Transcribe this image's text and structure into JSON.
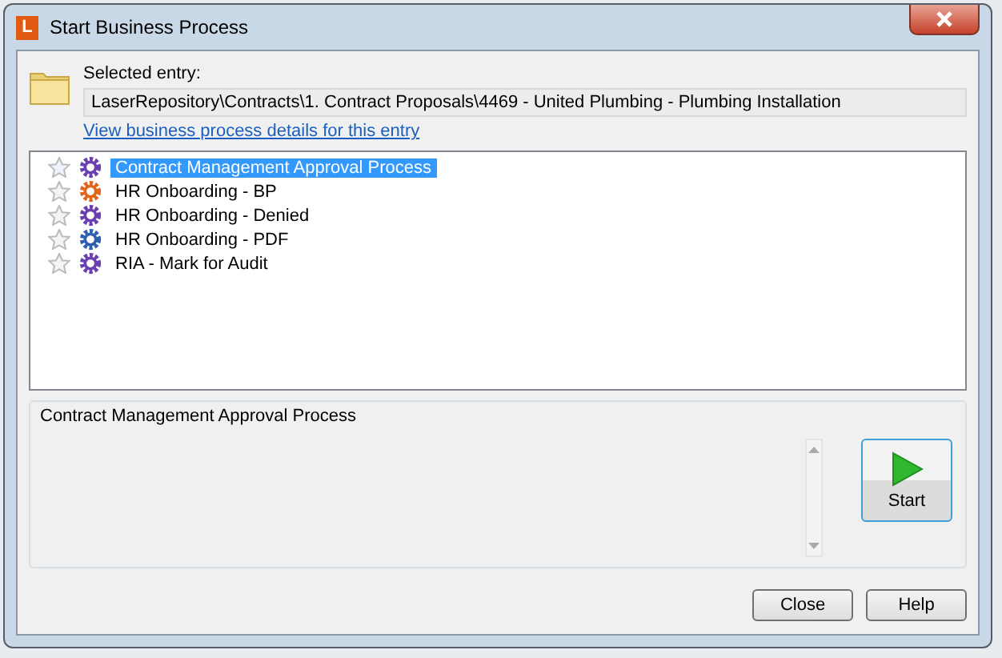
{
  "window": {
    "title": "Start Business Process",
    "app_letter": "L"
  },
  "selected_entry": {
    "label": "Selected entry:",
    "path": "LaserRepository\\Contracts\\1. Contract Proposals\\4469 - United Plumbing - Plumbing Installation",
    "link": "View business process details for this entry"
  },
  "processes": [
    {
      "name": "Contract Management Approval Process",
      "selected": true,
      "color": "#6a3fb0"
    },
    {
      "name": "HR Onboarding - BP",
      "selected": false,
      "color": "#e0661c"
    },
    {
      "name": "HR Onboarding - Denied",
      "selected": false,
      "color": "#6a3fb0"
    },
    {
      "name": "HR Onboarding - PDF",
      "selected": false,
      "color": "#2f5fb0"
    },
    {
      "name": "RIA - Mark for Audit",
      "selected": false,
      "color": "#6a3fb0"
    }
  ],
  "details": {
    "title": "Contract Management Approval Process",
    "start_label": "Start"
  },
  "buttons": [
    "Close",
    "Help"
  ]
}
